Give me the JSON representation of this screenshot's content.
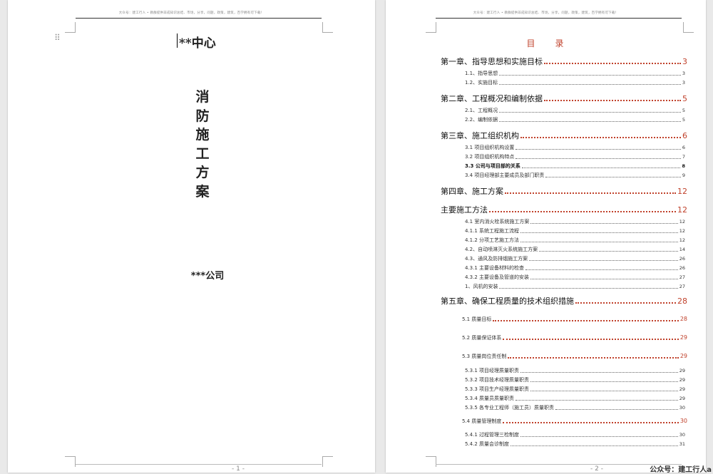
{
  "header_text": "大众号：建工行人 • 教群提供非成知识总结、市场，分享，问题，政策，建筑，百学拥有可下载！",
  "page1": {
    "org": "**中心",
    "title_chars": [
      "消",
      "防",
      "施",
      "工",
      "方",
      "案"
    ],
    "company": "***公司",
    "page_number": "- 1 -"
  },
  "page2": {
    "toc_title_left": "目",
    "toc_title_right": "录",
    "page_number": "- 2 -",
    "entries": [
      {
        "label": "第一章、指导思想和实施目标",
        "page": "3"
      },
      {
        "label": "1.1、指导思想",
        "page": "3"
      },
      {
        "label": "1.2、实施目标",
        "page": "3"
      },
      {
        "label": "第二章、工程概况和编制依据",
        "page": "5"
      },
      {
        "label": "2.1、工程概况",
        "page": "5"
      },
      {
        "label": "2.2、编制依据",
        "page": "5"
      },
      {
        "label": "第三章、施工组织机构",
        "page": "6"
      },
      {
        "label": "3.1 项目组织机构设置",
        "page": "6"
      },
      {
        "label": "3.2 项目组织机构特点",
        "page": "7"
      },
      {
        "label": "3.3 公司与项目部的关系",
        "page": "8"
      },
      {
        "label": "3.4 项目经理部主要成员及部门职责",
        "page": "9"
      },
      {
        "label": "第四章、施工方案",
        "page": "12"
      },
      {
        "label": "主要施工方法",
        "page": "12"
      },
      {
        "label": "4.1 室内消火栓系统施工方案",
        "page": "12"
      },
      {
        "label": "4.1.1  系统工程施工流程",
        "page": "12"
      },
      {
        "label": "4.1.2 分项工艺施工方法",
        "page": "12"
      },
      {
        "label": "4.2、自动喷淋灭火系统施工方案",
        "page": "14"
      },
      {
        "label": "4.3、通风及防排烟施工方案",
        "page": "26"
      },
      {
        "label": "4.3.1 主要设备材料的检查",
        "page": "26"
      },
      {
        "label": "4.3.2 主要设备及管道的安装",
        "page": "27"
      },
      {
        "label": "1、风机的安装",
        "page": "27"
      },
      {
        "label": "第五章、确保工程质量的技术组织措施",
        "page": "28"
      },
      {
        "label": "5.1 质量目标",
        "page": "28"
      },
      {
        "label": "5.2 质量保证体系",
        "page": "29"
      },
      {
        "label": "5.3 质量岗位责任制",
        "page": "29"
      },
      {
        "label": "5.3.1 项目经理质量职责",
        "page": "29"
      },
      {
        "label": "5.3.2 项目技术经理质量职责",
        "page": "29"
      },
      {
        "label": "5.3.3 项目生产经理质量职责",
        "page": "29"
      },
      {
        "label": "5.3.4 质量员质量职责",
        "page": "29"
      },
      {
        "label": "5.3.5 各专业工程师（施工员）质量职责",
        "page": "30"
      },
      {
        "label": "5.4 质量管理制度",
        "page": "30"
      },
      {
        "label": "5.4.1 过程管理三检制度",
        "page": "30"
      },
      {
        "label": "5.4.2 质量会诊制度",
        "page": "31"
      }
    ]
  },
  "watermark": "公众号：建工行人a",
  "colors": {
    "accent": "#c0412b",
    "page_bg": "#ffffff",
    "canvas_bg": "#e9e9e9"
  }
}
